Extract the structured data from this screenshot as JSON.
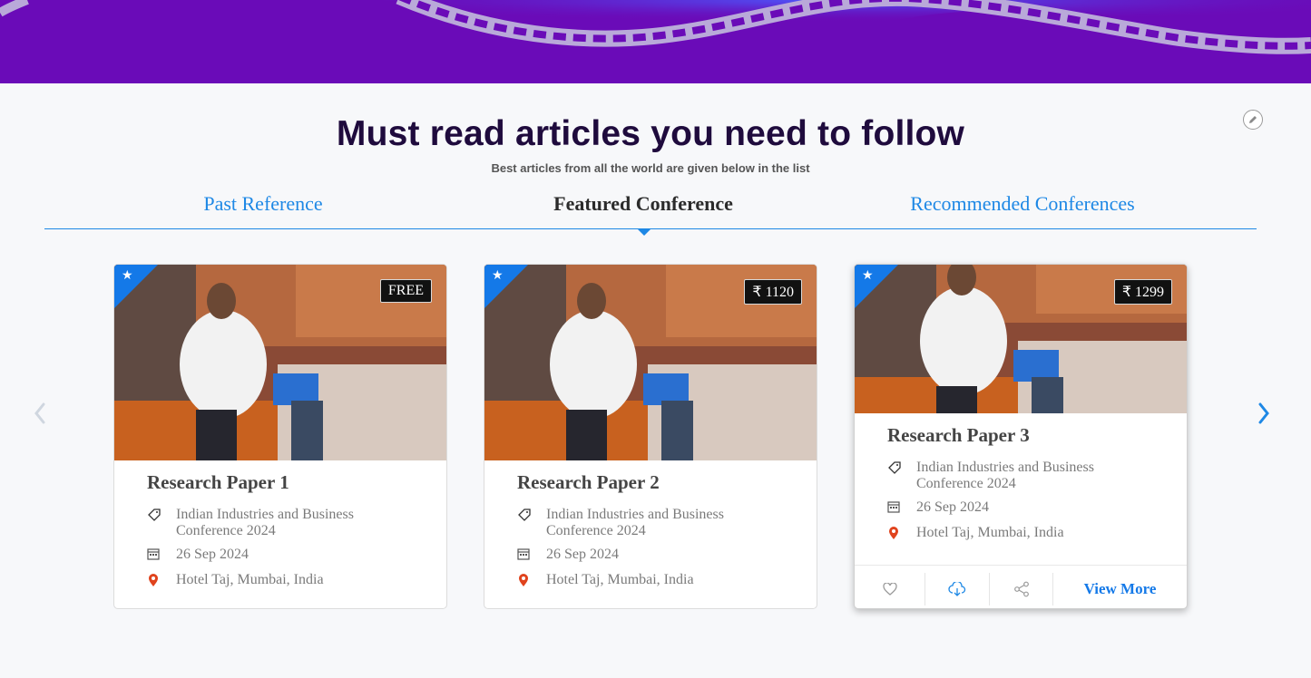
{
  "header": {
    "title": "Must read articles you need to follow",
    "subtitle": "Best articles from all the world are given below in the list"
  },
  "tabs": [
    {
      "label": "Past Reference",
      "active": false
    },
    {
      "label": "Featured Conference",
      "active": true
    },
    {
      "label": "Recommended Conferences",
      "active": false
    }
  ],
  "cards": [
    {
      "title": "Research Paper 1",
      "price": "FREE",
      "conference": "Indian Industries and Business Conference 2024",
      "date": "26 Sep 2024",
      "location": "Hotel Taj, Mumbai, India"
    },
    {
      "title": "Research Paper 2",
      "price": "₹ 1120",
      "conference": "Indian Industries and Business Conference 2024",
      "date": "26 Sep 2024",
      "location": "Hotel Taj, Mumbai, India"
    },
    {
      "title": "Research Paper 3",
      "price": "₹ 1299",
      "conference": "Indian Industries and Business Conference 2024",
      "date": "26 Sep 2024",
      "location": "Hotel Taj, Mumbai, India",
      "view_more": "View More"
    }
  ],
  "icons": {
    "ribbon": "star-icon",
    "tag": "tag-icon",
    "date": "calendar-icon",
    "location": "map-pin-icon",
    "like": "heart-icon",
    "download": "cloud-download-icon",
    "share": "share-icon",
    "edit": "pencil-icon",
    "prev": "chevron-left-icon",
    "next": "chevron-right-icon"
  },
  "colors": {
    "banner": "#6a0bb8",
    "accent": "#1e88e5",
    "title": "#1f0b3d",
    "pin": "#e0431d"
  }
}
